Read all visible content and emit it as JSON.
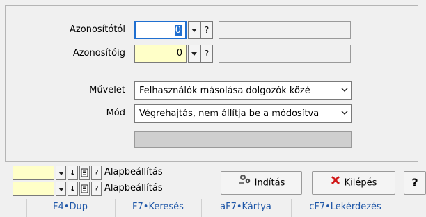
{
  "form": {
    "fields": [
      {
        "label": "Azonosítótól",
        "value": "0",
        "search": "?"
      },
      {
        "label": "Azonosítóig",
        "value": "0",
        "search": "?"
      }
    ],
    "muvelet_label": "Művelet",
    "muvelet_value": "Felhasználók másolása dolgozók közé",
    "mod_label": "Mód",
    "mod_value": "Végrehajtás, nem állítja be a módosítva"
  },
  "settings": [
    {
      "label": "Alapbeállítás",
      "help": "?"
    },
    {
      "label": "Alapbeállítás",
      "help": "?"
    }
  ],
  "buttons": {
    "start": "Indítás",
    "exit": "Kilépés",
    "help": "?"
  },
  "fkeys": [
    "F4•Dup",
    "F7•Keresés",
    "aF7•Kártya",
    "cF7•Lekérdezés"
  ],
  "colors": {
    "input_yellow": "#ffffc8",
    "focus_blue": "#1f6fd0",
    "fkey_text": "#1f57a8",
    "exit_red": "#d01818"
  }
}
